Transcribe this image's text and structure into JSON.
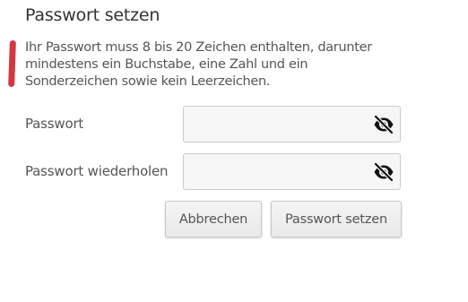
{
  "dialog": {
    "title": "Passwort setzen",
    "hint_lines": [
      "Ihr Passwort muss 8 bis 20 Zeichen enthalten, darunter",
      "mindestens ein Buchstabe, eine Zahl und ein",
      "Sonderzeichen sowie kein Leerzeichen."
    ]
  },
  "fields": {
    "password": {
      "label": "Passwort",
      "value": "",
      "placeholder": ""
    },
    "password_repeat": {
      "label": "Passwort wiederholen",
      "value": "",
      "placeholder": ""
    }
  },
  "buttons": {
    "cancel": "Abbrechen",
    "submit": "Passwort setzen"
  },
  "colors": {
    "annotation_mark": "#d0212e"
  },
  "icons": {
    "visibility_toggle": "eye-off-icon"
  }
}
